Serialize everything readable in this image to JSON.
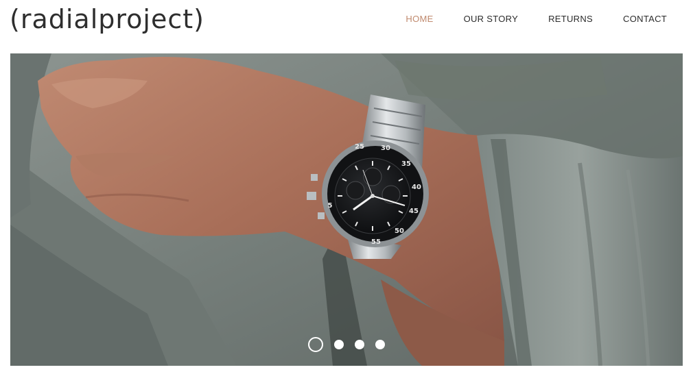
{
  "site": {
    "logo": "(radialproject)"
  },
  "nav": {
    "items": [
      {
        "label": "HOME",
        "active": true
      },
      {
        "label": "OUR STORY",
        "active": false
      },
      {
        "label": "RETURNS",
        "active": false
      },
      {
        "label": "CONTACT",
        "active": false
      }
    ]
  },
  "slideshow": {
    "slide_count": 4,
    "current_slide": 1
  },
  "watch": {
    "bezel_numbers": [
      "25",
      "30",
      "35",
      "40",
      "45",
      "50",
      "55",
      "5"
    ]
  },
  "colors": {
    "nav_active": "#c08a6e",
    "nav_text": "#2b2b2b",
    "logo_text": "#2e2e2e"
  }
}
